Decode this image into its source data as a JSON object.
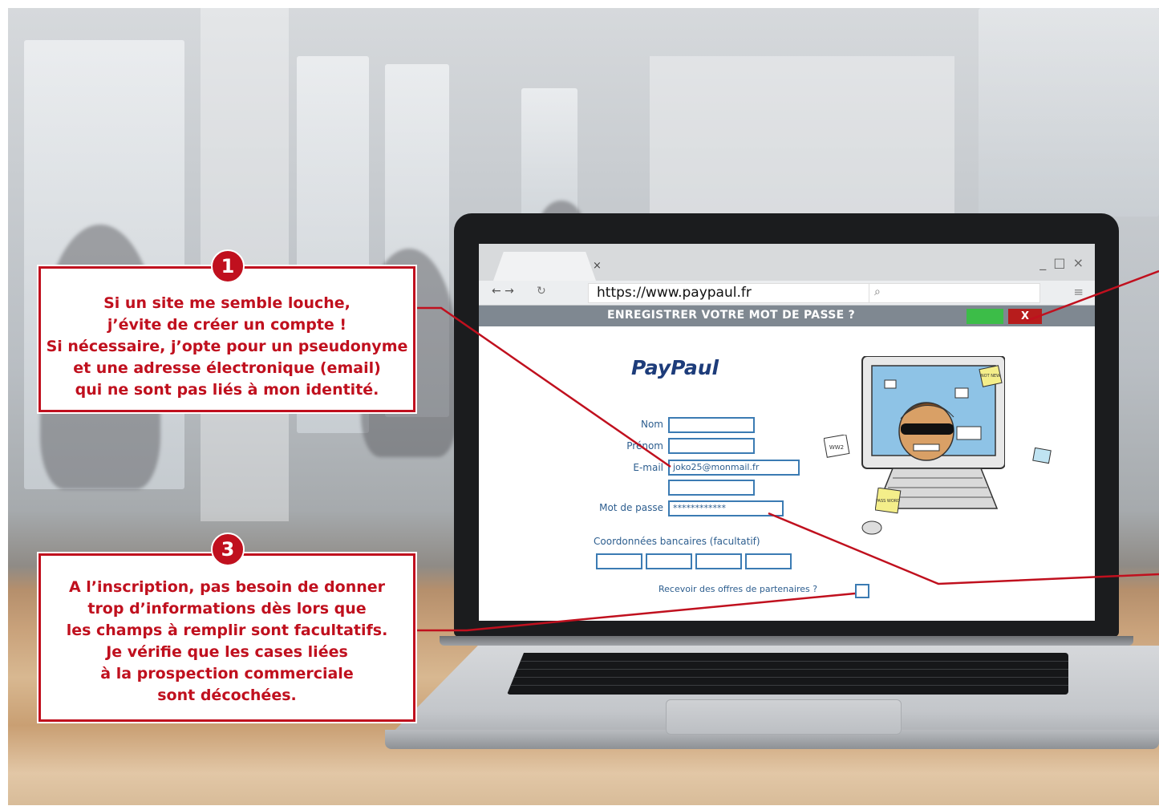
{
  "browser": {
    "tab_close": "×",
    "window_controls": "_ □ ×",
    "nav_arrows": "← →",
    "reload": "↻",
    "url": "https://www.paypaul.fr",
    "search_icon": "⌕",
    "menu_icon": "≡"
  },
  "password_bar": {
    "text": "ENREGISTRER VOTRE MOT DE PASSE ?",
    "close_label": "X"
  },
  "form": {
    "logo": "PayPaul",
    "nom_label": "Nom",
    "prenom_label": "Prénom",
    "email_label": "E-mail",
    "email_value": "joko25@monmail.fr",
    "password_label": "Mot de passe",
    "password_value": "************",
    "bank_label": "Coordonnées bancaires (facultatif)",
    "partner_label": "Recevoir des offres de partenaires ?"
  },
  "cartoon": {
    "note_top": "NOT NEW",
    "note_left": "WW2",
    "note_bottom": "PASS WORD"
  },
  "callouts": [
    {
      "number": "1",
      "lines": [
        "Si un site me semble louche,",
        "j’évite de créer un compte !",
        "Si nécessaire, j’opte pour un pseudonyme",
        "et une adresse électronique (email)",
        "qui ne sont pas liés à mon identité."
      ]
    },
    {
      "number": "3",
      "lines": [
        "A l’inscription, pas besoin de donner",
        "trop d’informations dès lors que",
        "les champs à remplir sont facultatifs.",
        "Je vérifie que les cases liées",
        "à la prospection commerciale",
        "sont décochées."
      ]
    }
  ],
  "colors": {
    "accent_red": "#c0101e",
    "form_blue": "#3b7bb3",
    "ok_green": "#3cbd48"
  }
}
